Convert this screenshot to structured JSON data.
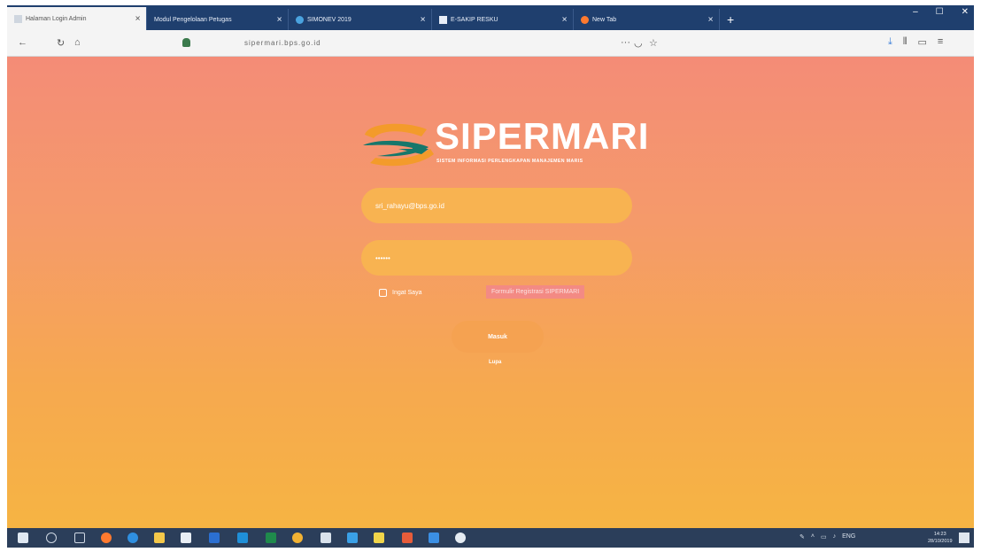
{
  "browser": {
    "tabs": [
      {
        "label": "Halaman Login Admin",
        "active": true
      },
      {
        "label": "Modul Pengelolaan Petugas",
        "active": false
      },
      {
        "label": "SIMONEV 2019",
        "active": false
      },
      {
        "label": "E-SAKIP RESKU",
        "active": false
      },
      {
        "label": "New Tab",
        "active": false
      }
    ],
    "url": "sipermari.bps.go.id"
  },
  "login": {
    "brand": "SIPERMARI",
    "tagline": "SISTEM INFORMASI PERLENGKAPAN MANAJEMEN MARIS",
    "email_value": "sri_rahayu@bps.go.id",
    "password_value": "••••••",
    "remember_label": "Ingat Saya",
    "register_label": "Formulir Registrasi SIPERMARI",
    "submit_label": "Masuk",
    "extra_link": "Lupa"
  },
  "taskbar": {
    "clock_time": "14:23",
    "clock_date": "28/10/2019",
    "language": "ENG"
  },
  "colors": {
    "page_top": "#f48c77",
    "page_bottom": "#f6b443",
    "brand_green": "#16776b",
    "brand_orange": "#f39b2b"
  }
}
